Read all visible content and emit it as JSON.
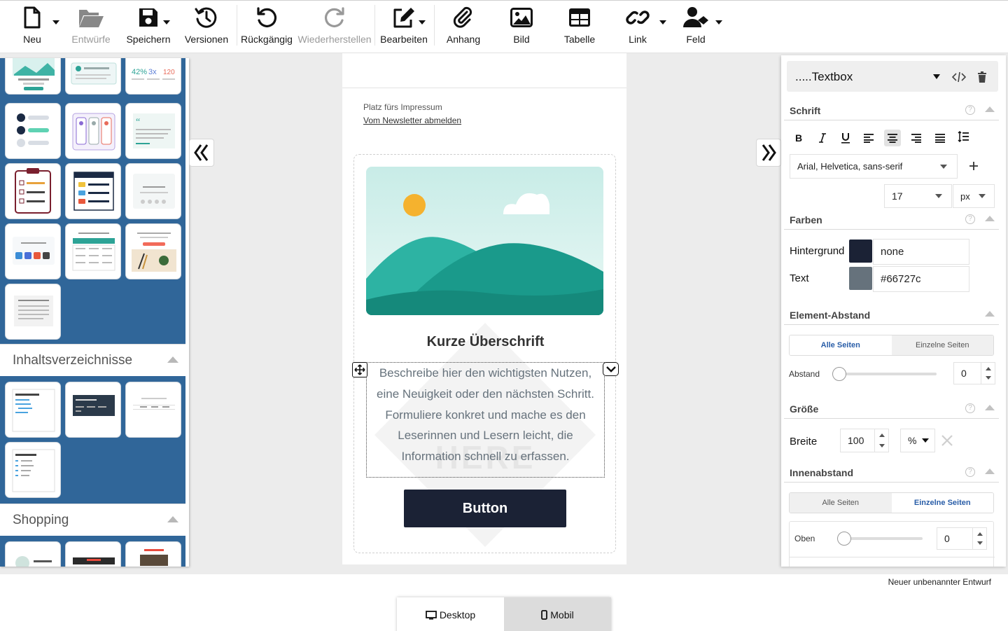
{
  "toolbar": {
    "new": "Neu",
    "drafts": "Entwürfe",
    "save": "Speichern",
    "versions": "Versionen",
    "undo": "Rückgängig",
    "redo": "Wiederherstellen",
    "edit": "Bearbeiten",
    "attachment": "Anhang",
    "image": "Bild",
    "table": "Tabelle",
    "link": "Link",
    "field": "Feld"
  },
  "left_panel": {
    "sections": [
      {
        "title": "Inhaltsverzeichnisse",
        "expanded": true
      },
      {
        "title": "Shopping",
        "expanded": true
      }
    ]
  },
  "canvas": {
    "imprint_placeholder": "Platz fürs Impressum",
    "unsubscribe_link": "Vom Newsletter abmelden",
    "heading": "Kurze Überschrift",
    "body_text": "Beschreibe hier den wichtigsten Nutzen, eine Neuigkeit oder den nächsten Schritt. Formuliere konkret und mache es den Leserinnen und Lesern leicht, die Information schnell zu erfassen.",
    "button_label": "Button",
    "watermark": "HERE"
  },
  "right_panel": {
    "element_selector": ".....Textbox",
    "font_section": "Schrift",
    "font_family": "Arial, Helvetica, sans-serif",
    "font_size": "17",
    "font_unit": "px",
    "colors_section": "Farben",
    "background_label": "Hintergrund",
    "background_value": "none",
    "background_swatch": "#1b2235",
    "text_label": "Text",
    "text_value": "#66727c",
    "text_swatch": "#66727c",
    "spacing_section": "Element-Abstand",
    "spacing_tab_all": "Alle Seiten",
    "spacing_tab_single": "Einzelne Seiten",
    "spacing_label": "Abstand",
    "spacing_value": "0",
    "size_section": "Größe",
    "width_label": "Breite",
    "width_value": "100",
    "width_unit": "%",
    "padding_section": "Innenabstand",
    "padding_tab_all": "Alle Seiten",
    "padding_tab_single": "Einzelne Seiten",
    "padding_top_label": "Oben",
    "padding_top_value": "0"
  },
  "footer": {
    "draft_name": "Neuer unbenannter Entwurf",
    "view_desktop": "Desktop",
    "view_mobile": "Mobil",
    "active_view": "Desktop"
  },
  "colors": {
    "accent_blue": "#306699",
    "active_tab_text": "#2a5ea8",
    "button_dark": "#1b2235"
  }
}
